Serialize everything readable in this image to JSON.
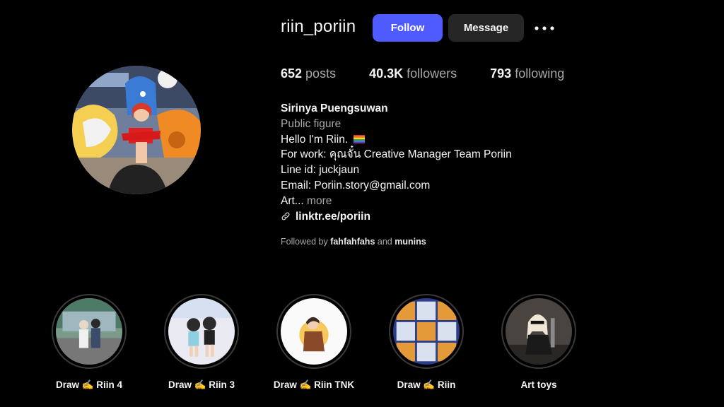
{
  "profile": {
    "username": "riin_poriin",
    "follow_label": "Follow",
    "message_label": "Message",
    "more_icon": "more-horizontal-icon"
  },
  "stats": {
    "posts_count": "652",
    "posts_label": "posts",
    "followers_count": "40.3K",
    "followers_label": "followers",
    "following_count": "793",
    "following_label": "following"
  },
  "bio": {
    "name": "Sirinya Puengsuwan",
    "category": "Public figure",
    "line1": "Hello I'm Riin.",
    "line2": "For work: คุณจั๋น Creative Manager Team Poriin",
    "line3": "Line id: juckjaun",
    "line4": "Email: Poriin.story@gmail.com",
    "line5": "Art...",
    "more_label": "more",
    "link": "linktr.ee/poriin",
    "link_icon": "link-icon",
    "flag_icon": "rainbow-flag-icon"
  },
  "followed_by": {
    "prefix": "Followed by",
    "user1": "fahfahfahs",
    "joiner": "and",
    "user2": "munins"
  },
  "highlights": [
    {
      "label": "Draw ✍️ Riin 4"
    },
    {
      "label": "Draw ✍️ Riin 3"
    },
    {
      "label": "Draw ✍️ Riin TNK"
    },
    {
      "label": "Draw ✍️ Riin"
    },
    {
      "label": "Art toys"
    }
  ],
  "colors": {
    "background": "#000000",
    "follow_button": "#4f5bff",
    "message_button": "#262626",
    "secondary_text": "#a8a8a8"
  }
}
